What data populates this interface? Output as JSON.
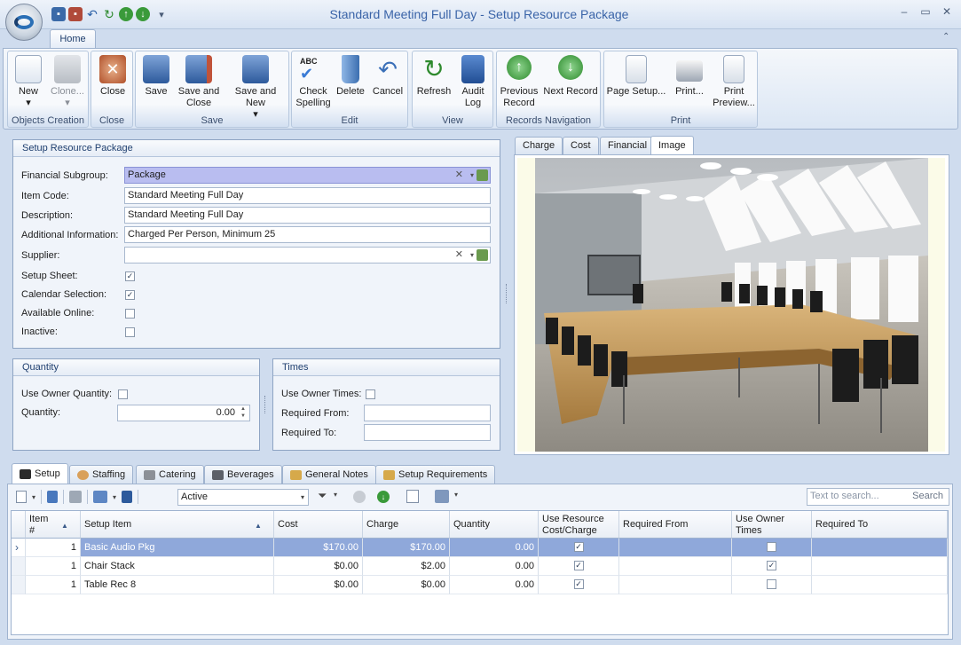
{
  "window": {
    "title": "Standard Meeting Full Day - Setup Resource Package"
  },
  "ribbon": {
    "tab": "Home",
    "groups": [
      {
        "label": "Objects Creation",
        "buttons": [
          "New",
          "Clone..."
        ]
      },
      {
        "label": "Close",
        "buttons": [
          "Close"
        ]
      },
      {
        "label": "Save",
        "buttons": [
          "Save",
          "Save and Close",
          "Save and New"
        ]
      },
      {
        "label": "Edit",
        "buttons": [
          "Check Spelling",
          "Delete",
          "Cancel"
        ]
      },
      {
        "label": "View",
        "buttons": [
          "Refresh",
          "Audit Log"
        ]
      },
      {
        "label": "Records Navigation",
        "buttons": [
          "Previous Record",
          "Next Record"
        ]
      },
      {
        "label": "Print",
        "buttons": [
          "Page Setup...",
          "Print...",
          "Print Preview..."
        ]
      }
    ],
    "labels": {
      "new": "New",
      "clone": "Clone...",
      "close": "Close",
      "save": "Save",
      "save_close_1": "Save and",
      "save_close_2": "Close",
      "save_new": "Save and New",
      "spell_1": "Check",
      "spell_2": "Spelling",
      "abc": "ABC",
      "delete": "Delete",
      "cancel": "Cancel",
      "refresh": "Refresh",
      "audit_1": "Audit",
      "audit_2": "Log",
      "prev_1": "Previous",
      "prev_2": "Record",
      "next": "Next Record",
      "page_setup": "Page Setup...",
      "print": "Print...",
      "preview_1": "Print",
      "preview_2": "Preview..."
    }
  },
  "setup_panel": {
    "title": "Setup Resource Package",
    "financial_subgroup_label": "Financial Subgroup:",
    "financial_subgroup": "Package",
    "item_code_label": "Item Code:",
    "item_code": "Standard Meeting Full Day",
    "description_label": "Description:",
    "description": "Standard Meeting Full Day",
    "additional_info_label": "Additional Information:",
    "additional_info": "Charged Per Person, Minimum 25",
    "supplier_label": "Supplier:",
    "supplier": "",
    "setup_sheet_label": "Setup Sheet:",
    "calendar_selection_label": "Calendar Selection:",
    "available_online_label": "Available Online:",
    "inactive_label": "Inactive:",
    "setup_sheet": true,
    "calendar_selection": true,
    "available_online": false,
    "inactive": false
  },
  "quantity_panel": {
    "title": "Quantity",
    "use_owner_quantity_label": "Use Owner Quantity:",
    "quantity_label": "Quantity:",
    "quantity": "0.00"
  },
  "times_panel": {
    "title": "Times",
    "use_owner_times_label": "Use Owner Times:",
    "required_from_label": "Required From:",
    "required_to_label": "Required To:"
  },
  "right_tabs": [
    "Charge",
    "Cost",
    "Financial",
    "Image"
  ],
  "bottom_tabs": [
    "Setup",
    "Staffing",
    "Catering",
    "Beverages",
    "General Notes",
    "Setup Requirements"
  ],
  "toolbar": {
    "filter": "Active",
    "search_placeholder": "Text to search...",
    "search_button": "Search"
  },
  "grid": {
    "columns": [
      "Item #",
      "Setup Item",
      "Cost",
      "Charge",
      "Quantity",
      "Use Resource Cost/Charge",
      "Required From",
      "Use Owner Times",
      "Required To"
    ],
    "col_item_1": "Item",
    "col_item_2": "#",
    "col_urc_1": "Use Resource",
    "col_urc_2": "Cost/Charge",
    "col_uot_1": "Use Owner",
    "col_uot_2": "Times",
    "rows": [
      {
        "item": "1",
        "setup_item": "Basic Audio Pkg",
        "cost": "$170.00",
        "charge": "$170.00",
        "quantity": "0.00",
        "use_resource": true,
        "use_owner_times": false
      },
      {
        "item": "1",
        "setup_item": "Chair Stack",
        "cost": "$0.00",
        "charge": "$2.00",
        "quantity": "0.00",
        "use_resource": true,
        "use_owner_times": true
      },
      {
        "item": "1",
        "setup_item": "Table Rec 8",
        "cost": "$0.00",
        "charge": "$0.00",
        "quantity": "0.00",
        "use_resource": true,
        "use_owner_times": false
      }
    ]
  }
}
